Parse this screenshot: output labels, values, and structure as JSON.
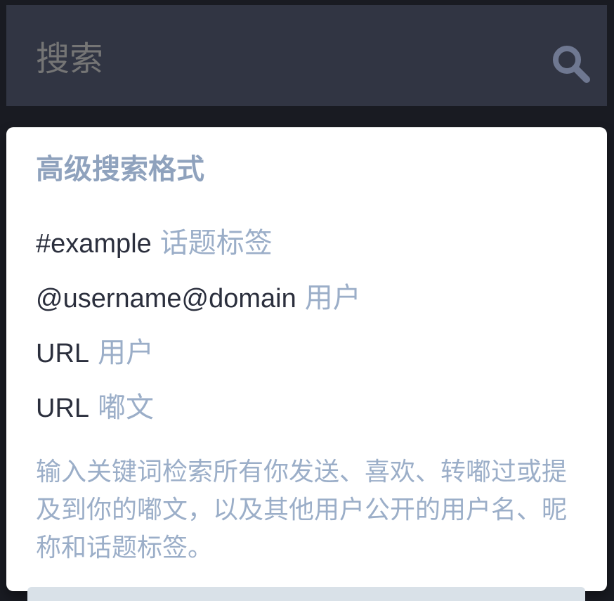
{
  "search": {
    "placeholder": "搜索",
    "icon": "search-icon"
  },
  "popout": {
    "title": "高级搜索格式",
    "items": [
      {
        "code": "#example",
        "desc": "话题标签"
      },
      {
        "code": "@username@domain",
        "desc": "用户"
      },
      {
        "code": "URL",
        "desc": "用户"
      },
      {
        "code": "URL",
        "desc": "嘟文"
      }
    ],
    "hint": "输入关键词检索所有你发送、喜欢、转嘟过或提及到你的嘟文，以及其他用户公开的用户名、昵称和话题标签。"
  },
  "colors": {
    "background": "#191b22",
    "search_bar": "#313543",
    "popout_bg": "#ffffff",
    "code_text": "#2b2f3d",
    "muted_text": "#9baec8"
  }
}
